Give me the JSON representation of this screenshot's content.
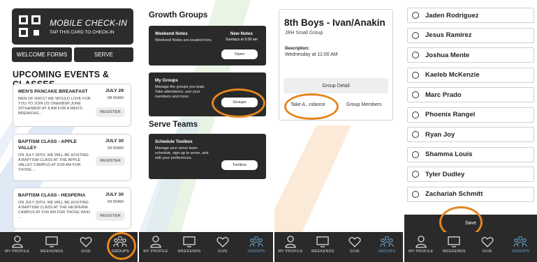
{
  "accent": "#e6861c",
  "tabbar": {
    "tabs": [
      {
        "label": "MY PROFILE",
        "icon": "person-icon"
      },
      {
        "label": "WEEKENDS",
        "icon": "monitor-icon"
      },
      {
        "label": "GIVE",
        "icon": "heart-icon"
      },
      {
        "label": "GROUPS",
        "icon": "people-icon"
      }
    ]
  },
  "panel1": {
    "checkin_title": "MOBILE CHECK-IN",
    "checkin_sub": "TAP THIS CARD TO CHECK-IN",
    "welcome_forms": "WELCOME FORMS",
    "serve": "SERVE",
    "section_title": "UPCOMING EVENTS & CLASSES",
    "events": [
      {
        "title": "MEN'S PANCAKE BREAKFAST",
        "date": "JULY 29",
        "time": "08:00AM",
        "desc": "MEN OF HDCC! WE WOULD LOVE FOR YOU TO JOIN US ON&NBSP;JUNE 29TH&NBSP;AT 8 AM FOR A MEN'S BREAKFAS...",
        "register": "REGISTER"
      },
      {
        "title": "BAPTISM CLASS - APPLE VALLEY",
        "date": "JULY 30",
        "time": "09:00AM",
        "desc": "ON JULY 30TH, WE WILL BE HOSTING A BAPTISM CLASS AT THE APPLE VALLEY CAMPUS AT 9:00 AM FOR THOSE ...",
        "register": "REGISTER"
      },
      {
        "title": "BAPTISM CLASS - HESPERIA",
        "date": "JULY 30",
        "time": "09:00AM",
        "desc": "ON JULY 30TH, WE WILL BE HOSTING A BAPTISM CLASS AT THE HESPERIA CAMPUS AT 9:00 AM FOR THOSE WHO ...",
        "register": "REGISTER"
      }
    ]
  },
  "panel2": {
    "growth_title": "Growth Groups",
    "weekend_notes": {
      "title": "Weekend Notes",
      "text": "Weekend Notes are located here.",
      "new_title": "New Notes",
      "new_sub": "Sundays at 9:00 am",
      "button": "Open"
    },
    "my_groups": {
      "title": "My Groups",
      "text": "Manage the groups you lead. Take attendance, see your members and more.",
      "button": "Groups"
    },
    "serve_title": "Serve Teams",
    "schedule": {
      "title": "Schedule Toolbox",
      "text": "Manage your serve team schedule, sign-up to serve, and edit your preferences.",
      "button": "Toolbox"
    }
  },
  "panel3": {
    "title": "8th Boys - Ivan/Anakin",
    "subtitle": "JRH Small Group",
    "desc_label": "Description:",
    "desc_value": "Wednesday at 11:00 AM",
    "group_detail": "Group Detail",
    "take_attendance": "Take A...ndance",
    "group_members": "Group Members"
  },
  "panel4": {
    "members": [
      "Jaden Rodriguez",
      "Jesus Ramirez",
      "Joshua Mente",
      "Kaeleb McKenzie",
      "Marc Prado",
      "Phoenix Rangel",
      "Ryan Joy",
      "Shamma Louis",
      "Tyler Dudley",
      "Zachariah Schmitt"
    ],
    "save": "Save"
  }
}
